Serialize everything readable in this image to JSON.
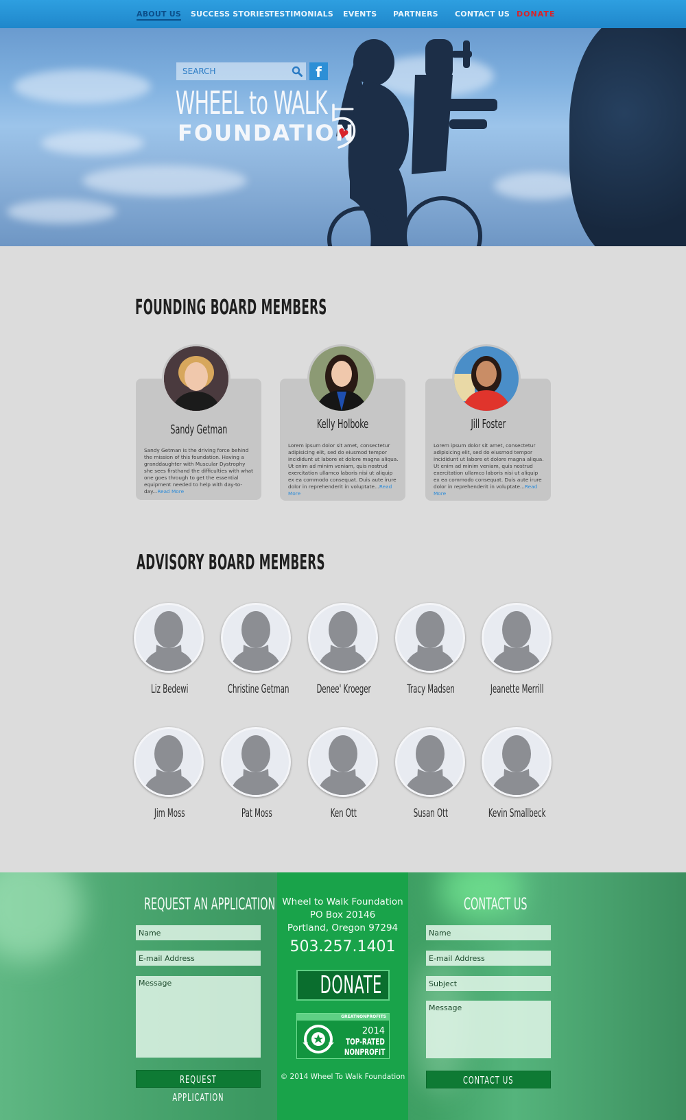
{
  "nav": {
    "items": [
      {
        "label": "ABOUT US"
      },
      {
        "label": "SUCCESS STORIES"
      },
      {
        "label": "TESTIMONIALS"
      },
      {
        "label": "EVENTS"
      },
      {
        "label": "PARTNERS"
      },
      {
        "label": "CONTACT US"
      },
      {
        "label": "DONATE"
      }
    ],
    "active_color": "#0c4f8a",
    "donate_color": "#d8232a"
  },
  "hero": {
    "search_placeholder": "SEARCH",
    "facebook_glyph": "f",
    "logo": {
      "line1": "WHEEL to WALK",
      "line2": "FOUNDATION"
    }
  },
  "founding": {
    "title": "FOUNDING BOARD MEMBERS",
    "members": [
      {
        "name": "Sandy Getman",
        "text": "Sandy Getman is the driving force behind the mission of this foundation.  Having a granddaughter with Muscular Dystrophy she sees firsthand the difficulties with what one goes through to get the essential equipment needed to help with day-to-day...",
        "link": "Read More"
      },
      {
        "name": "Kelly Holboke",
        "text": "Lorem ipsum dolor sit amet, consectetur adipisicing elit, sed do eiusmod tempor incididunt ut labore et dolore magna aliqua. Ut enim ad minim veniam, quis nostrud exercitation ullamco laboris nisi ut aliquip ex ea commodo consequat. Duis aute irure dolor in reprehenderit in voluptate...",
        "link": "Read More"
      },
      {
        "name": "Jill Foster",
        "text": "Lorem ipsum dolor sit amet, consectetur adipisicing elit, sed do eiusmod tempor incididunt ut labore et dolore magna aliqua. Ut enim ad minim veniam, quis nostrud exercitation ullamco laboris nisi ut aliquip ex ea commodo consequat. Duis aute irure dolor in reprehenderit in voluptate...",
        "link": "Read More"
      }
    ]
  },
  "advisory": {
    "title": "ADVISORY BOARD MEMBERS",
    "members": [
      {
        "name": "Liz Bedewi"
      },
      {
        "name": "Christine Getman"
      },
      {
        "name": "Denee' Kroeger"
      },
      {
        "name": "Tracy Madsen"
      },
      {
        "name": "Jeanette Merrill"
      },
      {
        "name": "Jim Moss"
      },
      {
        "name": "Pat Moss"
      },
      {
        "name": "Ken Ott"
      },
      {
        "name": "Susan Ott"
      },
      {
        "name": "Kevin Smallbeck"
      }
    ]
  },
  "footer": {
    "application": {
      "title": "REQUEST AN APPLICATION",
      "name_placeholder": "Name",
      "email_placeholder": "E-mail Address",
      "message_placeholder": "Message",
      "button": "REQUEST APPLICATION"
    },
    "center": {
      "org": "Wheel to Walk Foundation",
      "po_box": "PO Box 20146",
      "city": "Portland, Oregon 97294",
      "phone": "503.257.1401",
      "donate": "DONATE",
      "badge_header": "GREATNONPROFITS",
      "badge_year": "2014",
      "badge_line1": "TOP-RATED",
      "badge_line2": "NONPROFIT",
      "copyright": "© 2014 Wheel To Walk Foundation"
    },
    "contact": {
      "title": "CONTACT US",
      "name_placeholder": "Name",
      "email_placeholder": "E-mail Address",
      "subject_placeholder": "Subject",
      "message_placeholder": "Message",
      "button": "CONTACT US"
    }
  }
}
